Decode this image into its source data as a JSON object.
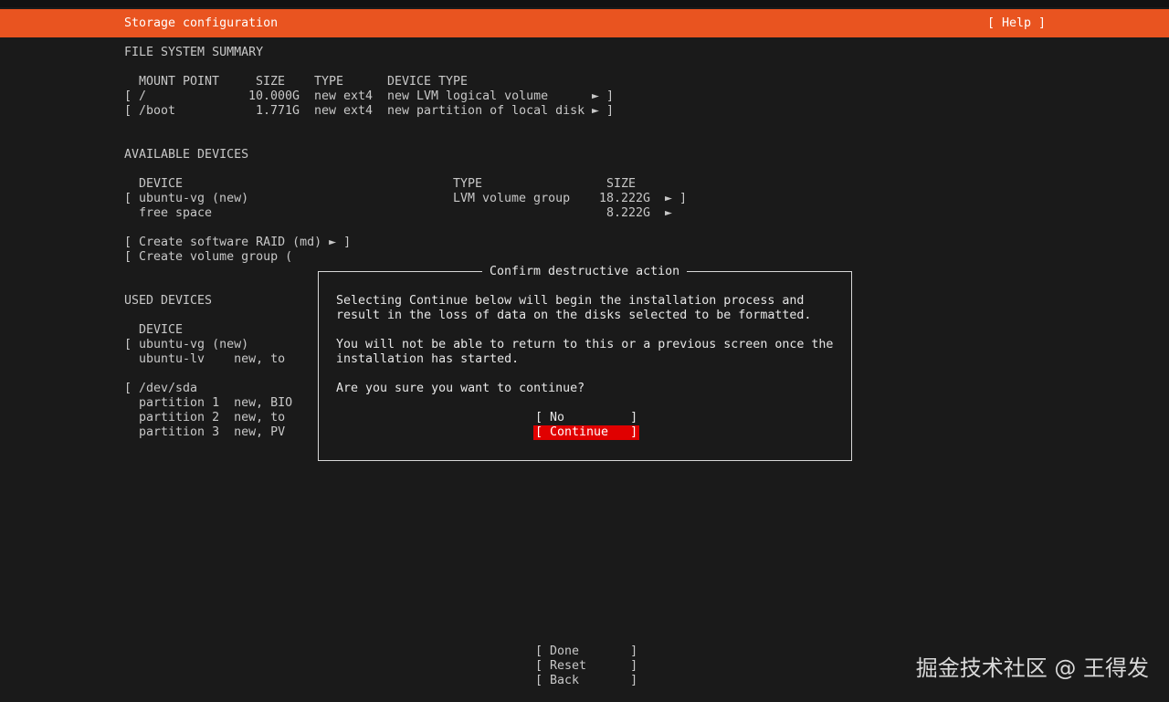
{
  "header": {
    "title": "Storage configuration",
    "help": "[ Help ]"
  },
  "fs_summary": {
    "title": "FILE SYSTEM SUMMARY",
    "headers": {
      "mount_point": "MOUNT POINT",
      "size": "SIZE",
      "type": "TYPE",
      "device_type": "DEVICE TYPE"
    },
    "rows": [
      {
        "open": "[",
        "mount": "/",
        "size": "10.000G",
        "type": "new ext4",
        "device_type": "new LVM logical volume",
        "arrow": "►",
        "close": "]"
      },
      {
        "open": "[",
        "mount": "/boot",
        "size": "1.771G",
        "type": "new ext4",
        "device_type": "new partition of local disk",
        "arrow": "►",
        "close": "]"
      }
    ]
  },
  "available": {
    "title": "AVAILABLE DEVICES",
    "headers": {
      "device": "DEVICE",
      "type": "TYPE",
      "size": "SIZE"
    },
    "rows": [
      {
        "open": "[",
        "device": "ubuntu-vg (new)",
        "type": "LVM volume group",
        "size": "18.222G",
        "arrow": "►",
        "close": "]"
      },
      {
        "device": "free space",
        "size": "8.222G",
        "arrow": "►"
      }
    ],
    "actions": [
      "[ Create software RAID (md) ► ]",
      "[ Create volume group ("
    ]
  },
  "used": {
    "title": "USED DEVICES",
    "header_device": "DEVICE",
    "lines": [
      "[ ubuntu-vg (new)",
      "  ubuntu-lv    new, to",
      "",
      "[ /dev/sda",
      "  partition 1  new, BIO",
      "  partition 2  new, to",
      "  partition 3  new, PV"
    ]
  },
  "dialog": {
    "title": "Confirm destructive action",
    "paragraph1": [
      "Selecting Continue below will begin the installation process and",
      "result in the loss of data on the disks selected to be formatted."
    ],
    "paragraph2": [
      "You will not be able to return to this or a previous screen once the",
      "installation has started."
    ],
    "question": "Are you sure you want to continue?",
    "no_button": "[ No         ]",
    "continue_button": "[ Continue   ]",
    "selected_color": "#e00000"
  },
  "footer": {
    "done": "[ Done       ]",
    "reset": "[ Reset      ]",
    "back": "[ Back       ]"
  },
  "watermark": "掘金技术社区 @ 王得发",
  "colors": {
    "accent": "#e95420",
    "background": "#1a1a1a",
    "text": "#c8c8c8"
  }
}
